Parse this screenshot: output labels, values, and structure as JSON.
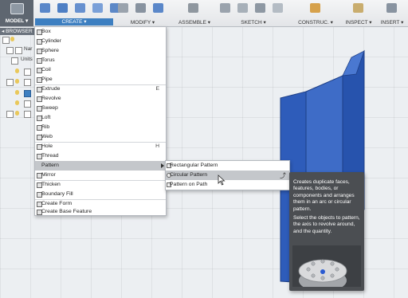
{
  "toolbar": {
    "model_label": "MODEL ▾",
    "groups": [
      {
        "label": "CREATE ▾"
      },
      {
        "label": "MODIFY ▾"
      },
      {
        "label": "ASSEMBLE ▾"
      },
      {
        "label": "SKETCH ▾"
      },
      {
        "label": "CONSTRUC. ▾"
      },
      {
        "label": "INSPECT ▾"
      },
      {
        "label": "INSERT ▾"
      }
    ]
  },
  "browser": {
    "header": "◂ BROWSER",
    "items": [
      "Nar",
      "Units"
    ]
  },
  "create_menu": {
    "items": [
      {
        "label": "Box",
        "shortcut": ""
      },
      {
        "label": "Cylinder",
        "shortcut": ""
      },
      {
        "label": "Sphere",
        "shortcut": ""
      },
      {
        "label": "Torus",
        "shortcut": ""
      },
      {
        "label": "Coil",
        "shortcut": ""
      },
      {
        "label": "Pipe",
        "shortcut": ""
      },
      {
        "label": "Extrude",
        "shortcut": "E"
      },
      {
        "label": "Revolve",
        "shortcut": ""
      },
      {
        "label": "Sweep",
        "shortcut": ""
      },
      {
        "label": "Loft",
        "shortcut": ""
      },
      {
        "label": "Rib",
        "shortcut": ""
      },
      {
        "label": "Web",
        "shortcut": ""
      },
      {
        "label": "Hole",
        "shortcut": "H"
      },
      {
        "label": "Thread",
        "shortcut": ""
      },
      {
        "label": "Pattern",
        "shortcut": ""
      },
      {
        "label": "Mirror",
        "shortcut": ""
      },
      {
        "label": "Thicken",
        "shortcut": ""
      },
      {
        "label": "Boundary Fill",
        "shortcut": ""
      },
      {
        "label": "Create Form",
        "shortcut": ""
      },
      {
        "label": "Create Base Feature",
        "shortcut": ""
      }
    ]
  },
  "pattern_submenu": {
    "items": [
      {
        "label": "Rectangular Pattern"
      },
      {
        "label": "Circular Pattern"
      },
      {
        "label": "Pattern on Path"
      }
    ]
  },
  "tooltip": {
    "para1": "Creates duplicate faces, features, bodies, or components and arranges them in an arc or circular pattern.",
    "para2": "Select the objects to pattern, the axis to revolve around, and the quantity."
  },
  "colors": {
    "accent": "#3d7fc1",
    "body_blue": "#2f5fb8",
    "menu_highlight": "#c4c7cb",
    "tooltip_bg": "#4b4e52"
  },
  "icons": [
    "box-icon",
    "cylinder-icon",
    "sphere-icon",
    "torus-icon",
    "coil-icon",
    "pipe-icon",
    "extrude-icon",
    "revolve-icon",
    "sweep-icon",
    "loft-icon",
    "rib-icon",
    "web-icon",
    "hole-icon",
    "thread-icon",
    "pattern-icon",
    "mirror-icon",
    "thicken-icon",
    "boundary-fill-icon",
    "create-form-icon",
    "create-base-feature-icon",
    "pin-icon"
  ]
}
